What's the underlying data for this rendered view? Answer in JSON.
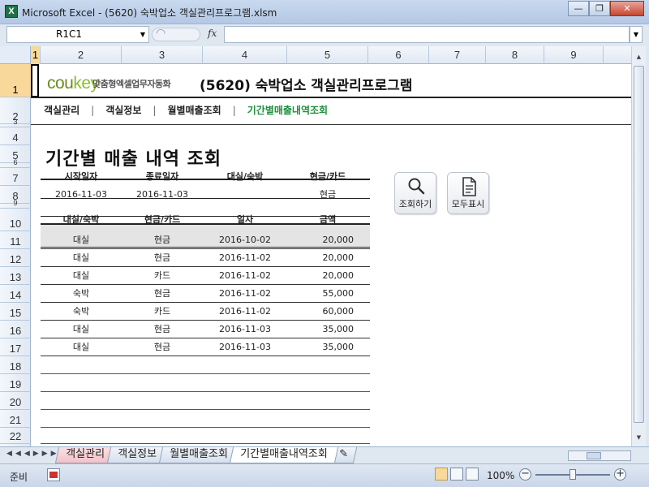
{
  "window": {
    "title": "Microsoft Excel - (5620) 숙박업소 객실관리프로그램.xlsm",
    "app_icon": "X",
    "buttons": {
      "minimize": "—",
      "restore": "❐",
      "close": "✕"
    }
  },
  "formula_bar": {
    "name_box": "R1C1",
    "fx": "fx",
    "formula": ""
  },
  "columns": [
    "1",
    "2",
    "3",
    "4",
    "5",
    "6",
    "7",
    "8",
    "9"
  ],
  "rows": [
    "1",
    "2",
    "3",
    "4",
    "5",
    "6",
    "7",
    "8",
    "9",
    "10",
    "11",
    "12",
    "13",
    "14",
    "15",
    "16",
    "17",
    "18",
    "19",
    "20",
    "21",
    "22"
  ],
  "header": {
    "logo_main": "cou",
    "logo_key": "key",
    "logo_sub": "맞춤형엑셀업무자동화",
    "app_title": "(5620) 숙박업소 객실관리프로그램"
  },
  "nav": {
    "items": [
      "객실관리",
      "객실정보",
      "월별매출조회",
      "기간별매출내역조회"
    ],
    "separator": "|",
    "active": "기간별매출내역조회"
  },
  "page_title": "기간별 매출 내역 조회",
  "search": {
    "headers": [
      "시작일자",
      "종료일자",
      "대실/숙박",
      "현금/카드"
    ],
    "values": [
      "2016-11-03",
      "2016-11-03",
      "",
      "현금"
    ]
  },
  "results": {
    "headers": [
      "대실/숙박",
      "현금/카드",
      "일자",
      "금액"
    ],
    "rows": [
      [
        "대실",
        "현금",
        "2016-10-02",
        "20,000"
      ],
      [
        "대실",
        "현금",
        "2016-11-02",
        "20,000"
      ],
      [
        "대실",
        "카드",
        "2016-11-02",
        "20,000"
      ],
      [
        "숙박",
        "현금",
        "2016-11-02",
        "55,000"
      ],
      [
        "숙박",
        "카드",
        "2016-11-02",
        "60,000"
      ],
      [
        "대실",
        "현금",
        "2016-11-03",
        "35,000"
      ],
      [
        "대실",
        "현금",
        "2016-11-03",
        "35,000"
      ]
    ]
  },
  "actions": {
    "search_label": "조회하기",
    "show_all_label": "모두표시"
  },
  "sheet_tabs": [
    "객실관리",
    "객실정보",
    "월별매출조회",
    "기간별매출내역조회"
  ],
  "active_tab": "기간별매출내역조회",
  "status": {
    "ready": "준비",
    "zoom": "100%"
  },
  "colors": {
    "accent_green": "#1e8f3c",
    "logo_green": "#6a8d20",
    "header_gray": "#e4e4e4"
  }
}
